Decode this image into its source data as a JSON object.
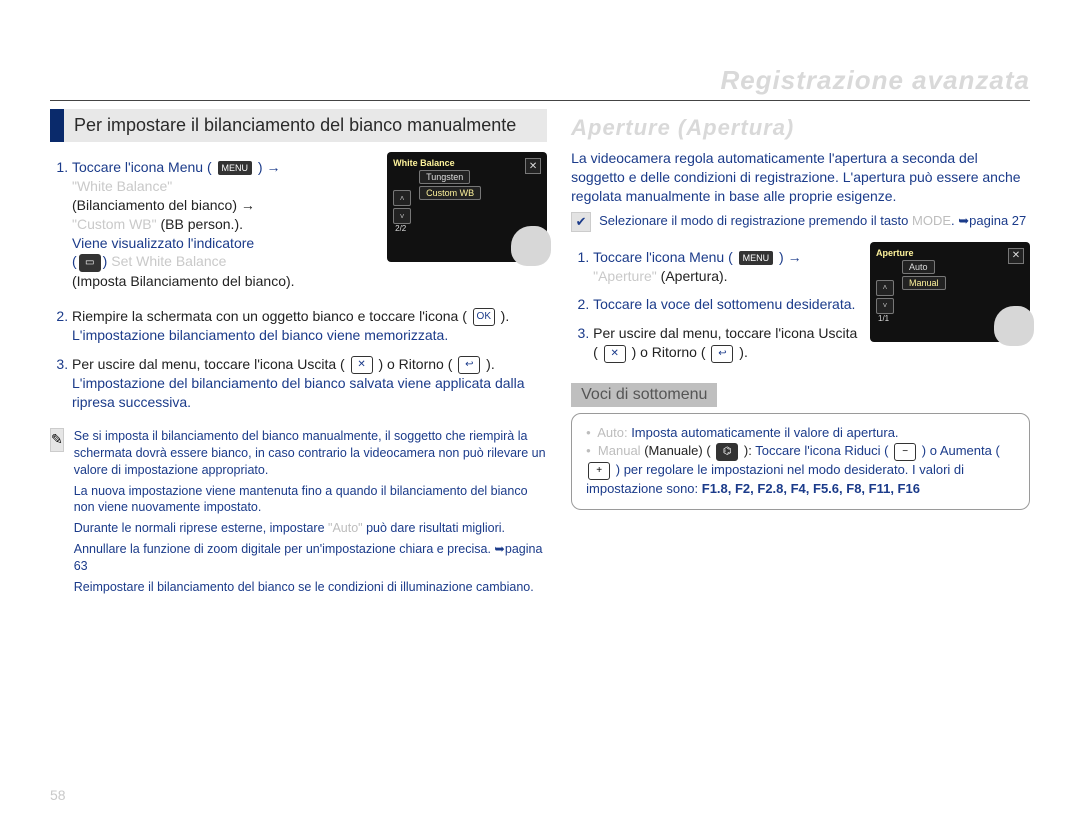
{
  "header": {
    "section": "Registrazione avanzata"
  },
  "left": {
    "bar_title": "Per impostare il bilanciamento del bianco manualmente",
    "step1": {
      "t1": "Toccare l'icona Menu (",
      "menu": "MENU",
      "t2": ") →",
      "wb": "\"White Balance\"",
      "wb_it": "(Bilanciamento del bianco) →",
      "cwb": "\"Custom WB\"",
      "cwb_it": "(BB person.).",
      "t3": "Viene visualizzato l'indicatore",
      "swb": "Set White Balance",
      "swb_it": "(Imposta Bilanciamento del bianco)."
    },
    "step2": {
      "a": "Riempire la schermata con un oggetto bianco e toccare l'icona (",
      "b": ").",
      "c": "L'impostazione bilanciamento del bianco viene memorizzata."
    },
    "step3": {
      "a": "Per uscire dal menu, toccare l'icona Uscita (",
      "b": ") o Ritorno (",
      "c": ").",
      "d": "L'impostazione del bilanciamento del bianco salvata viene applicata dalla ripresa successiva."
    },
    "note": {
      "p1": "Se si imposta il bilanciamento del bianco manualmente, il soggetto che riempirà la schermata dovrà essere bianco, in caso contrario la videocamera non può rilevare un valore di impostazione appropriato.",
      "p2": "La nuova impostazione viene mantenuta fino a quando il bilanciamento del bianco non viene nuovamente impostato.",
      "p3a": "Durante le normali riprese esterne, impostare ",
      "p3auto": "\"Auto\"",
      "p3b": " può dare risultati migliori.",
      "p4": "Annullare la funzione di zoom digitale per un'impostazione chiara e precisa. ➥pagina 63",
      "p5": "Reimpostare il bilanciamento del bianco se le condizioni di illuminazione cambiano."
    },
    "screen": {
      "title": "White Balance",
      "opt1": "Tungsten",
      "opt2": "Custom WB",
      "page": "2/2"
    }
  },
  "right": {
    "head": "Aperture (Apertura)",
    "intro": "La videocamera regola automaticamente l'apertura a seconda del soggetto e delle condizioni di registrazione. L'apertura può essere anche regolata manualmente in base alle proprie esigenze.",
    "pre": {
      "a": "Selezionare il modo di registrazione premendo il tasto ",
      "mode": "MODE",
      "b": ". ➥pagina 27"
    },
    "step1": {
      "a": "Toccare l'icona Menu (",
      "menu": "MENU",
      "b": ") →",
      "ap": "\"Aperture\"",
      "ap_it": "(Apertura)."
    },
    "step2": "Toccare la voce del sottomenu desiderata.",
    "step3": {
      "a": "Per uscire dal menu, toccare l'icona Uscita (",
      "b": ") o Ritorno (",
      "c": ")."
    },
    "subhead": "Voci di sottomenu",
    "sub": {
      "auto_lbl": "Auto:",
      "auto_txt": " Imposta automaticamente il valore di apertura.",
      "man_lbl": "Manual",
      "man_it": " (Manuale) (",
      "man_after_icon": "): ",
      "man_txt1": "Toccare l'icona Riduci (",
      "man_txt2": ") o Aumenta (",
      "man_txt3": ") per regolare le impostazioni nel modo desiderato. I valori di impostazione sono: ",
      "fvalues": "F1.8, F2, F2.8, F4, F5.6, F8, F11, F16"
    },
    "screen": {
      "title": "Aperture",
      "opt1": "Auto",
      "opt2": "Manual",
      "page": "1/1"
    }
  },
  "icons": {
    "ok": "OK",
    "x": "✕",
    "back": "↩",
    "minus": "−",
    "plus": "+",
    "dial": "⌬",
    "note": "✎",
    "check": "✔",
    "up": "˄",
    "down": "˅"
  },
  "pagenum": "58"
}
